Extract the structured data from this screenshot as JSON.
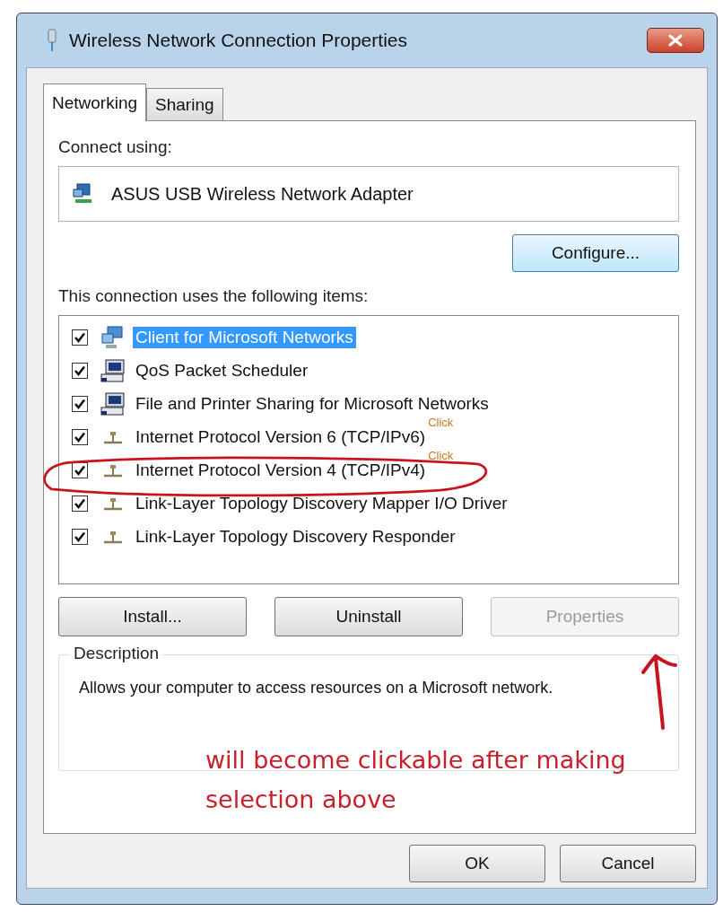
{
  "window": {
    "title": "Wireless Network Connection Properties"
  },
  "tabs": [
    {
      "label": "Networking",
      "selected": true
    },
    {
      "label": "Sharing",
      "selected": false
    }
  ],
  "connect_using": {
    "label": "Connect using:",
    "adapter": "ASUS USB Wireless Network Adapter",
    "button": "Configure..."
  },
  "items_label": "This connection uses the following items:",
  "items": [
    {
      "label": "Client for Microsoft Networks",
      "kind": "client",
      "checked": true,
      "selected": true,
      "circled": false
    },
    {
      "label": "QoS Packet Scheduler",
      "kind": "service",
      "checked": true,
      "selected": false,
      "circled": false
    },
    {
      "label": "File and Printer Sharing for Microsoft Networks",
      "kind": "service",
      "checked": true,
      "selected": false,
      "circled": false
    },
    {
      "label": "Internet Protocol Version 6 (TCP/IPv6)",
      "kind": "protocol",
      "checked": true,
      "selected": false,
      "circled": false,
      "note": "Click"
    },
    {
      "label": "Internet Protocol Version 4 (TCP/IPv4)",
      "kind": "protocol",
      "checked": true,
      "selected": false,
      "circled": true,
      "note": "Click"
    },
    {
      "label": "Link-Layer Topology Discovery Mapper I/O Driver",
      "kind": "protocol",
      "checked": true,
      "selected": false,
      "circled": false
    },
    {
      "label": "Link-Layer Topology Discovery Responder",
      "kind": "protocol",
      "checked": true,
      "selected": false,
      "circled": false
    }
  ],
  "item_buttons": [
    {
      "label": "Install...",
      "disabled": false
    },
    {
      "label": "Uninstall",
      "disabled": false
    },
    {
      "label": "Properties",
      "disabled": true
    }
  ],
  "description": {
    "title": "Description",
    "text": "Allows your computer to access resources on a Microsoft network."
  },
  "annotation": {
    "text": "will become clickable after making selection above"
  },
  "dialog_buttons": [
    {
      "label": "OK"
    },
    {
      "label": "Cancel"
    }
  ]
}
